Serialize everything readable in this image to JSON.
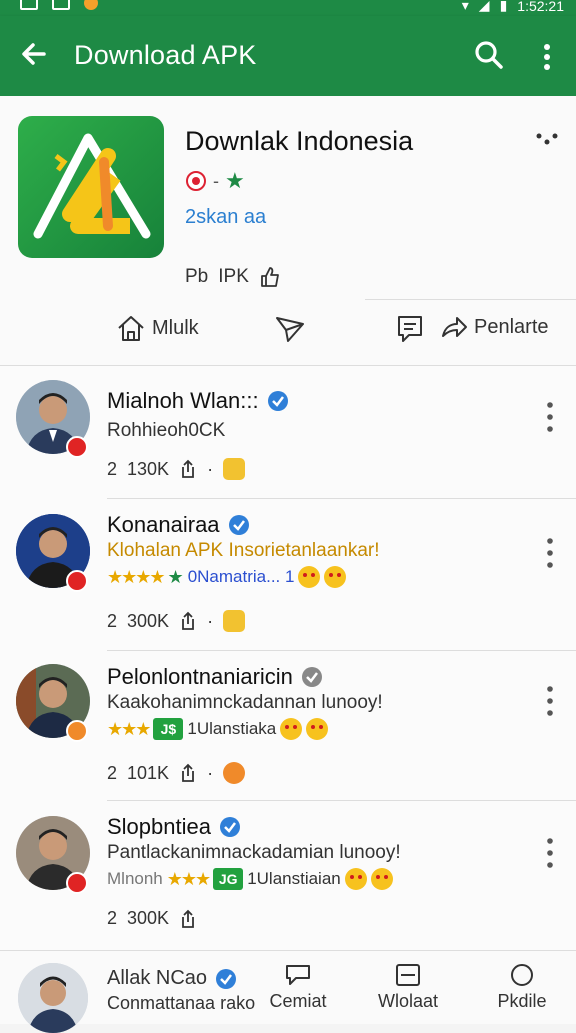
{
  "status_bar": {
    "time": "1:52:21"
  },
  "app_bar": {
    "title": "Download APK",
    "back_icon": "arrow-left-icon",
    "search_icon": "search-icon",
    "more_icon": "more-vertical-icon"
  },
  "app": {
    "name": "Downlak Indonesia",
    "meta_separator": "-",
    "subtitle": "2skan aa",
    "info_left": "Pb",
    "info_mid": "IPK",
    "actions": {
      "home_label": "Mlulk",
      "share_label": "",
      "comment_label": "",
      "forward_label": "Penlarte"
    }
  },
  "posts": [
    {
      "name": "Mialnoh Wlan:::",
      "verified": true,
      "text": "Rohhieoh0CK",
      "stat_num": "2",
      "stat_count": "130K",
      "stat_dot": "·"
    },
    {
      "name": "Konanairaa",
      "verified": true,
      "text": "Klohalan APK Insorietanlaankar!",
      "rating_text": "0Namatria... 1",
      "stat_num": "2",
      "stat_count": "300K",
      "stat_dot": "·"
    },
    {
      "name": "Pelonlontnaniaricin",
      "verified": true,
      "text": "Kaakohanimnckadannan lunooy!",
      "rating_badge": "J$",
      "rating_text": "1Ulanstiaka",
      "stat_num": "2",
      "stat_count": "101K",
      "stat_dot": "·"
    },
    {
      "name": "Slopbntiea",
      "verified": true,
      "text": "Pantlackanimnackadamian lunooy!",
      "rating_prefix": "Mlnonh",
      "rating_badge": "JG",
      "rating_text": "1Ulanstiaian",
      "stat_num": "2",
      "stat_count": "300K"
    }
  ],
  "bottom_bar": {
    "name": "Allak NCao",
    "sub": "Conmattanaa rako",
    "items": [
      {
        "label": "Cemiat",
        "icon": "chat-icon"
      },
      {
        "label": "Wlolaat",
        "icon": "window-icon"
      },
      {
        "label": "Pkdile",
        "icon": "circle-icon"
      }
    ]
  },
  "colors": {
    "primary": "#1e8a45",
    "link": "#2b7fd0",
    "verified": "#2f7fd8",
    "star": "#e8a800"
  }
}
